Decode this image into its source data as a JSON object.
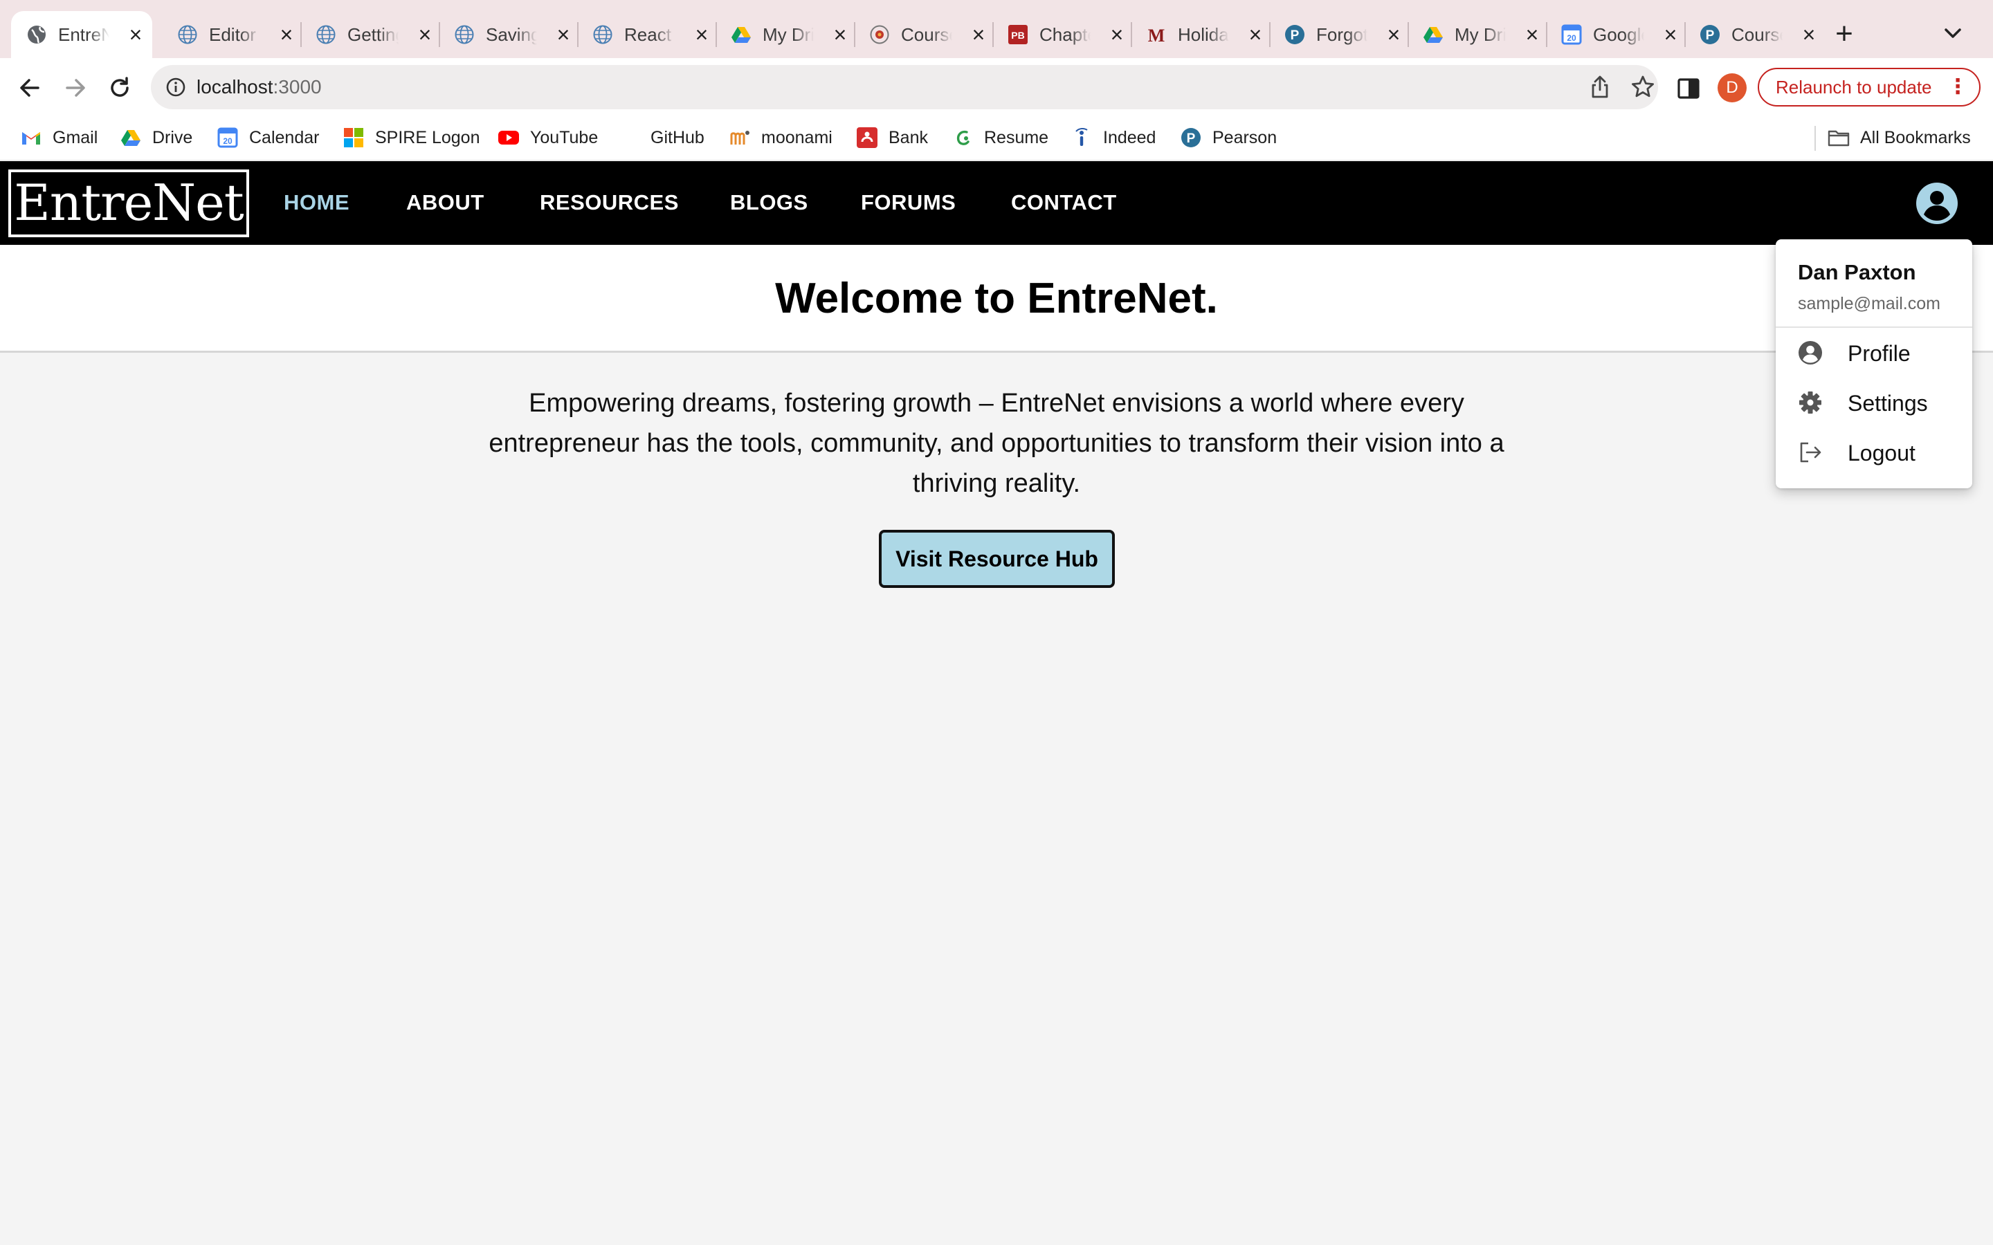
{
  "browser": {
    "tabs": [
      {
        "title": "EntreNet",
        "active": true,
        "favicon": "globe-icon"
      },
      {
        "title": "Editor",
        "favicon": "web-icon"
      },
      {
        "title": "Getting",
        "favicon": "web-icon"
      },
      {
        "title": "Saving",
        "favicon": "web-icon"
      },
      {
        "title": "React",
        "favicon": "web-icon"
      },
      {
        "title": "My Drive",
        "favicon": "drive-icon"
      },
      {
        "title": "Course",
        "favicon": "course-icon"
      },
      {
        "title": "Chapter",
        "favicon": "pb-icon",
        "favicon_text": "PB"
      },
      {
        "title": "Holiday",
        "favicon": "m-icon",
        "favicon_text": "M"
      },
      {
        "title": "Forgot",
        "favicon": "pearson-icon",
        "favicon_text": "P"
      },
      {
        "title": "My Drive",
        "favicon": "drive-icon"
      },
      {
        "title": "Google",
        "favicon": "calendar-icon",
        "favicon_text": "20"
      },
      {
        "title": "Course",
        "favicon": "pearson-icon",
        "favicon_text": "P"
      }
    ],
    "tab_close_glyph": "×",
    "new_tab_glyph": "+",
    "url_host": "localhost",
    "url_port": ":3000",
    "profile_initial": "D",
    "relaunch_label": "Relaunch to update",
    "relaunch_menu_glyph": "⋮",
    "bookmarks": [
      {
        "label": "Gmail",
        "icon": "gmail-icon"
      },
      {
        "label": "Drive",
        "icon": "drive-icon"
      },
      {
        "label": "Calendar",
        "icon": "calendar-icon",
        "icon_text": "20"
      },
      {
        "label": "SPIRE Logon",
        "icon": "windows-icon"
      },
      {
        "label": "YouTube",
        "icon": "youtube-icon"
      },
      {
        "label": "GitHub",
        "icon": "github-icon"
      },
      {
        "label": "moonami",
        "icon": "moonami-icon"
      },
      {
        "label": "Bank",
        "icon": "bank-icon"
      },
      {
        "label": "Resume",
        "icon": "resume-icon"
      },
      {
        "label": "Indeed",
        "icon": "indeed-icon"
      },
      {
        "label": "Pearson",
        "icon": "pearson-icon",
        "icon_text": "P"
      }
    ],
    "all_bookmarks_label": "All Bookmarks"
  },
  "site": {
    "logo": "EntreNet",
    "nav": [
      {
        "label": "HOME",
        "active": true
      },
      {
        "label": "ABOUT"
      },
      {
        "label": "RESOURCES"
      },
      {
        "label": "BLOGS"
      },
      {
        "label": "FORUMS"
      },
      {
        "label": "CONTACT"
      }
    ],
    "heading": "Welcome to EntreNet.",
    "mission": "Empowering dreams, fostering growth – EntreNet envisions a world where every entrepreneur has the tools, community, and opportunities to transform their vision into a thriving reality.",
    "cta_label": "Visit Resource Hub",
    "colors": {
      "nav_bg": "#000000",
      "nav_active": "#a9d4e6",
      "cta_bg": "#add8e6",
      "page_bg": "#f4f4f4"
    }
  },
  "account_menu": {
    "name": "Dan Paxton",
    "email": "sample@mail.com",
    "items": [
      {
        "label": "Profile",
        "icon": "account-circle-icon"
      },
      {
        "label": "Settings",
        "icon": "gear-icon"
      },
      {
        "label": "Logout",
        "icon": "logout-icon"
      }
    ]
  }
}
